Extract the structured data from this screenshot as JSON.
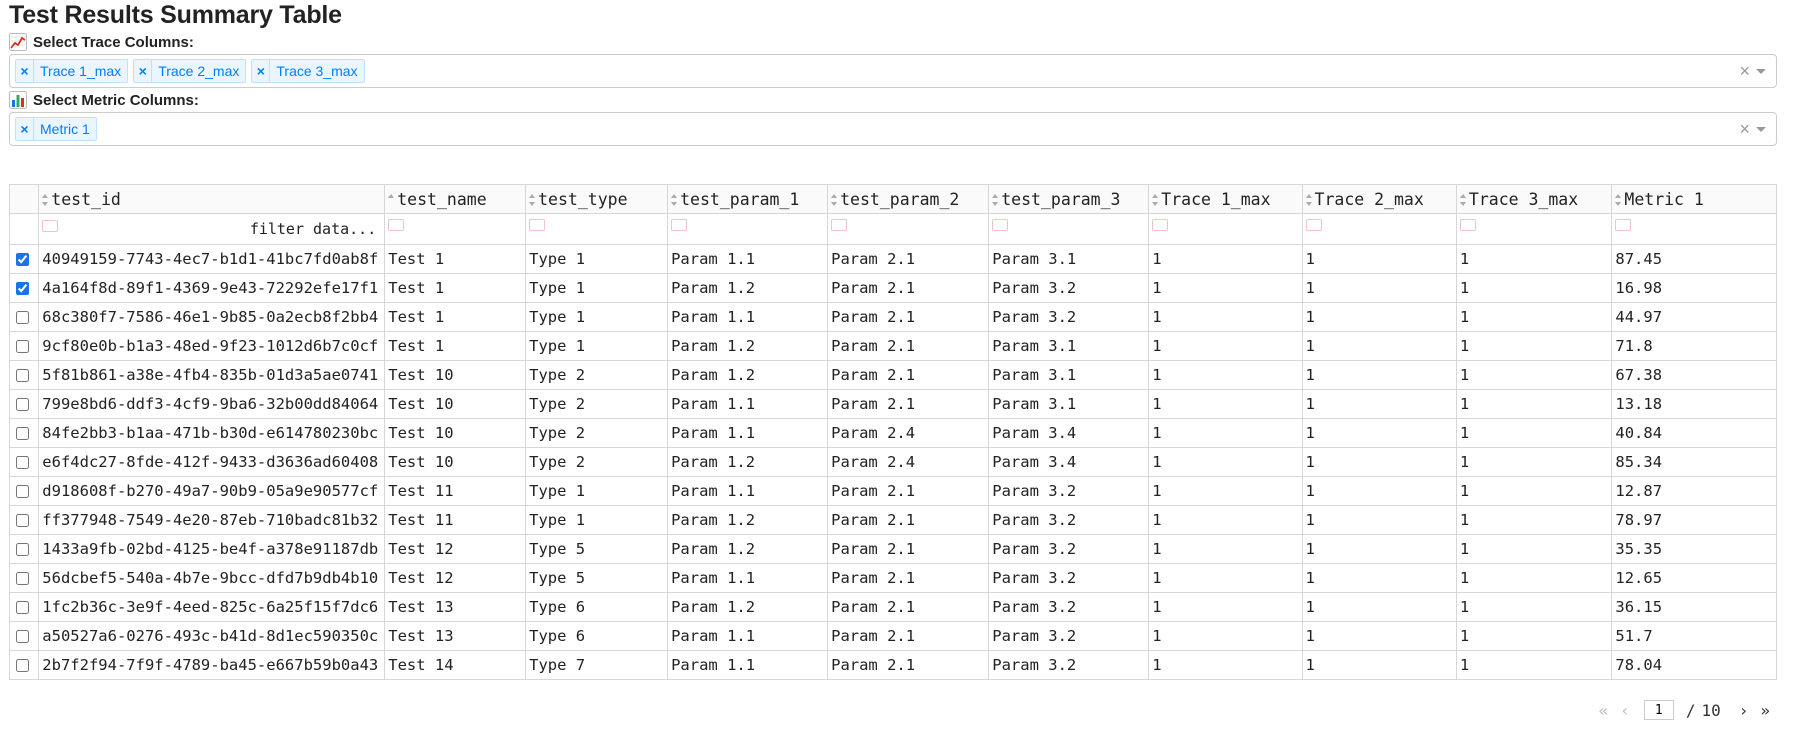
{
  "page": {
    "title": "Test Results Summary Table"
  },
  "trace_select": {
    "label": "Select Trace Columns:",
    "icon": "line-chart-icon",
    "selected": [
      "Trace 1_max",
      "Trace 2_max",
      "Trace 3_max"
    ],
    "remove_glyph": "×",
    "clear_glyph": "×"
  },
  "metric_select": {
    "label": "Select Metric Columns:",
    "icon": "bar-chart-icon",
    "selected": [
      "Metric 1"
    ],
    "remove_glyph": "×",
    "clear_glyph": "×"
  },
  "table": {
    "columns": [
      "test_id",
      "test_name",
      "test_type",
      "test_param_1",
      "test_param_2",
      "test_param_3",
      "Trace 1_max",
      "Trace 2_max",
      "Trace 3_max",
      "Metric 1"
    ],
    "filter_placeholder": "filter data...",
    "rows": [
      {
        "checked": true,
        "cells": [
          "40949159-7743-4ec7-b1d1-41bc7fd0ab8f",
          "Test 1",
          "Type 1",
          "Param 1.1",
          "Param 2.1",
          "Param 3.1",
          "1",
          "1",
          "1",
          "87.45"
        ]
      },
      {
        "checked": true,
        "cells": [
          "4a164f8d-89f1-4369-9e43-72292efe17f1",
          "Test 1",
          "Type 1",
          "Param 1.2",
          "Param 2.1",
          "Param 3.2",
          "1",
          "1",
          "1",
          "16.98"
        ]
      },
      {
        "checked": false,
        "cells": [
          "68c380f7-7586-46e1-9b85-0a2ecb8f2bb4",
          "Test 1",
          "Type 1",
          "Param 1.1",
          "Param 2.1",
          "Param 3.2",
          "1",
          "1",
          "1",
          "44.97"
        ]
      },
      {
        "checked": false,
        "cells": [
          "9cf80e0b-b1a3-48ed-9f23-1012d6b7c0cf",
          "Test 1",
          "Type 1",
          "Param 1.2",
          "Param 2.1",
          "Param 3.1",
          "1",
          "1",
          "1",
          "71.8"
        ]
      },
      {
        "checked": false,
        "cells": [
          "5f81b861-a38e-4fb4-835b-01d3a5ae0741",
          "Test 10",
          "Type 2",
          "Param 1.2",
          "Param 2.1",
          "Param 3.1",
          "1",
          "1",
          "1",
          "67.38"
        ]
      },
      {
        "checked": false,
        "cells": [
          "799e8bd6-ddf3-4cf9-9ba6-32b00dd84064",
          "Test 10",
          "Type 2",
          "Param 1.1",
          "Param 2.1",
          "Param 3.1",
          "1",
          "1",
          "1",
          "13.18"
        ]
      },
      {
        "checked": false,
        "cells": [
          "84fe2bb3-b1aa-471b-b30d-e614780230bc",
          "Test 10",
          "Type 2",
          "Param 1.1",
          "Param 2.4",
          "Param 3.4",
          "1",
          "1",
          "1",
          "40.84"
        ]
      },
      {
        "checked": false,
        "cells": [
          "e6f4dc27-8fde-412f-9433-d3636ad60408",
          "Test 10",
          "Type 2",
          "Param 1.2",
          "Param 2.4",
          "Param 3.4",
          "1",
          "1",
          "1",
          "85.34"
        ]
      },
      {
        "checked": false,
        "cells": [
          "d918608f-b270-49a7-90b9-05a9e90577cf",
          "Test 11",
          "Type 1",
          "Param 1.1",
          "Param 2.1",
          "Param 3.2",
          "1",
          "1",
          "1",
          "12.87"
        ]
      },
      {
        "checked": false,
        "cells": [
          "ff377948-7549-4e20-87eb-710badc81b32",
          "Test 11",
          "Type 1",
          "Param 1.2",
          "Param 2.1",
          "Param 3.2",
          "1",
          "1",
          "1",
          "78.97"
        ]
      },
      {
        "checked": false,
        "cells": [
          "1433a9fb-02bd-4125-be4f-a378e91187db",
          "Test 12",
          "Type 5",
          "Param 1.2",
          "Param 2.1",
          "Param 3.2",
          "1",
          "1",
          "1",
          "35.35"
        ]
      },
      {
        "checked": false,
        "cells": [
          "56dcbef5-540a-4b7e-9bcc-dfd7b9db4b10",
          "Test 12",
          "Type 5",
          "Param 1.1",
          "Param 2.1",
          "Param 3.2",
          "1",
          "1",
          "1",
          "12.65"
        ]
      },
      {
        "checked": false,
        "cells": [
          "1fc2b36c-3e9f-4eed-825c-6a25f15f7dc6",
          "Test 13",
          "Type 6",
          "Param 1.2",
          "Param 2.1",
          "Param 3.2",
          "1",
          "1",
          "1",
          "36.15"
        ]
      },
      {
        "checked": false,
        "cells": [
          "a50527a6-0276-493c-b41d-8d1ec590350c",
          "Test 13",
          "Type 6",
          "Param 1.1",
          "Param 2.1",
          "Param 3.2",
          "1",
          "1",
          "1",
          "51.7"
        ]
      },
      {
        "checked": false,
        "cells": [
          "2b7f2f94-7f9f-4789-ba45-e667b59b0a43",
          "Test 14",
          "Type 7",
          "Param 1.1",
          "Param 2.1",
          "Param 3.2",
          "1",
          "1",
          "1",
          "78.04"
        ]
      }
    ]
  },
  "pagination": {
    "first_glyph": "«",
    "prev_glyph": "‹",
    "current_page": "1",
    "separator": "/",
    "total_pages": "10",
    "next_glyph": "›",
    "last_glyph": "»"
  },
  "colors": {
    "chip_bg": "#ebf5ff",
    "chip_text": "#007eff",
    "chip_border": "#c2e0ff"
  }
}
